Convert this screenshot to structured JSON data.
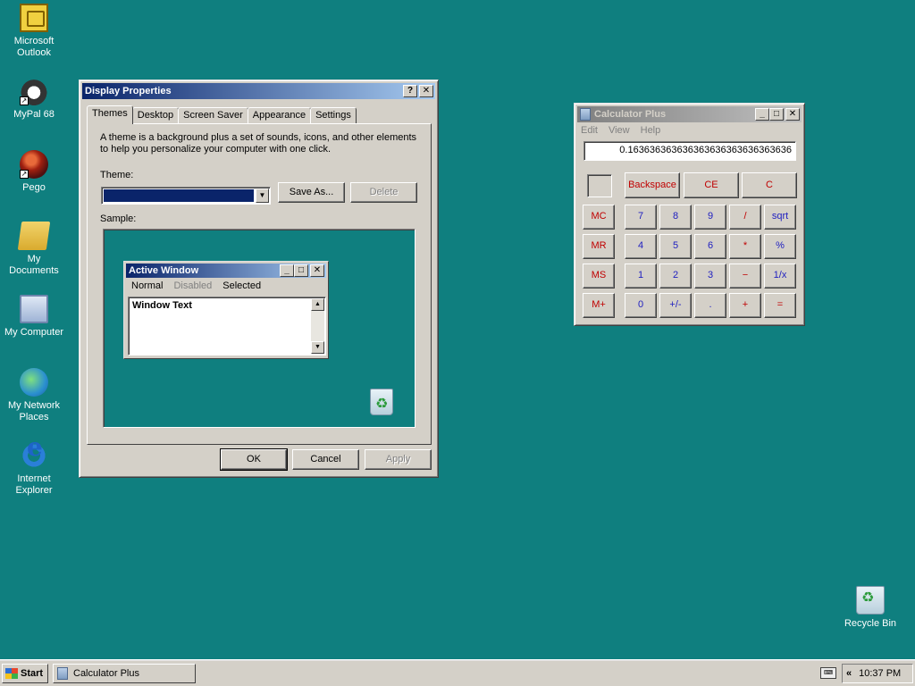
{
  "desktop": {
    "icons": [
      {
        "label": "Microsoft\nOutlook",
        "icon": "outlook-icon"
      },
      {
        "label": "MyPal 68",
        "icon": "mypal-icon"
      },
      {
        "label": "Pego",
        "icon": "pego-icon"
      },
      {
        "label": "My Documents",
        "icon": "folder-icon"
      },
      {
        "label": "My Computer",
        "icon": "computer-icon"
      },
      {
        "label": "My Network\nPlaces",
        "icon": "network-icon"
      },
      {
        "label": "Internet\nExplorer",
        "icon": "ie-icon"
      }
    ],
    "recycle_bin": "Recycle Bin"
  },
  "display_properties": {
    "title": "Display Properties",
    "help_glyph": "?",
    "close_glyph": "✕",
    "tabs": [
      "Themes",
      "Desktop",
      "Screen Saver",
      "Appearance",
      "Settings"
    ],
    "selected_tab": "Themes",
    "description_line1": "A theme is a background plus a set of sounds, icons, and other elements",
    "description_line2": "to help you personalize your computer with one click.",
    "theme_label": "Theme:",
    "theme_value": "",
    "save_as": "Save As...",
    "delete": "Delete",
    "sample_label": "Sample:",
    "sample_window": {
      "title": "Active Window",
      "menu_normal": "Normal",
      "menu_disabled": "Disabled",
      "menu_selected": "Selected",
      "text": "Window Text"
    },
    "ok": "OK",
    "cancel": "Cancel",
    "apply": "Apply"
  },
  "calculator": {
    "title": "Calculator Plus",
    "menu": [
      "Edit",
      "View",
      "Help"
    ],
    "display": "0.163636363636363636363636363636",
    "keys": {
      "backspace": "Backspace",
      "ce": "CE",
      "c": "C",
      "mc": "MC",
      "mr": "MR",
      "ms": "MS",
      "mplus": "M+",
      "k7": "7",
      "k8": "8",
      "k9": "9",
      "div": "/",
      "sqrt": "sqrt",
      "k4": "4",
      "k5": "5",
      "k6": "6",
      "mul": "*",
      "pct": "%",
      "k1": "1",
      "k2": "2",
      "k3": "3",
      "sub": "−",
      "inv": "1/x",
      "k0": "0",
      "sign": "+/-",
      "dot": ".",
      "add": "+",
      "eq": "="
    }
  },
  "taskbar": {
    "start": "Start",
    "tasks": [
      "Calculator Plus"
    ],
    "tray_chevron": "«",
    "clock": "10:37 PM"
  },
  "colors": {
    "desktop": "#0f7f7f",
    "active_title": "#0a246a",
    "inactive_title": "#808080",
    "calc_red": "#c00000",
    "calc_blue": "#2020c0"
  }
}
